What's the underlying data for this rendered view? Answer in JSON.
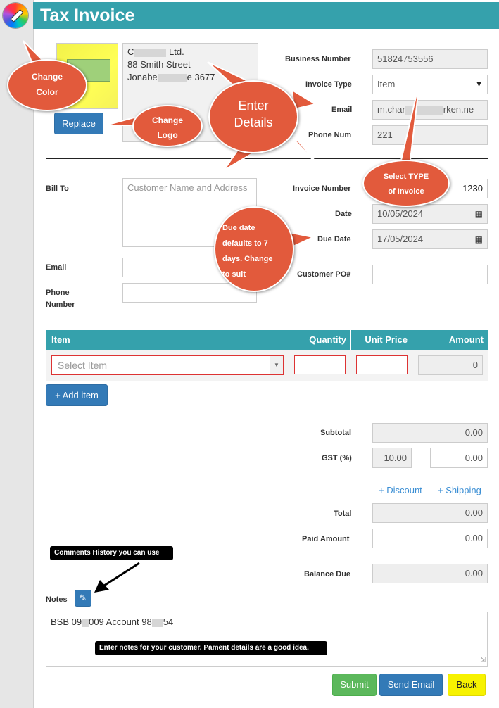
{
  "header": {
    "title": "Tax Invoice"
  },
  "company": {
    "lines": [
      "C",
      "Ltd.",
      "88 Smith Street",
      "Jonabe",
      "e 3677"
    ],
    "replace_label": "Replace"
  },
  "business": {
    "business_number_label": "Business Number",
    "business_number_value": "51824753556",
    "invoice_type_label": "Invoice Type",
    "invoice_type_value": "Item",
    "email_label": "Email",
    "email_value_start": "m.char",
    "email_value_end": "rken.ne",
    "phone_label": "Phone Num",
    "phone_value": "221"
  },
  "bill_to": {
    "label": "Bill To",
    "placeholder": "Customer Name and Address",
    "email_label": "Email",
    "phone_label_1": "Phone",
    "phone_label_2": "Number"
  },
  "invoice": {
    "number_label": "Invoice Number",
    "number_value": "1230",
    "date_label": "Date",
    "date_value": "10/05/2024",
    "due_label": "Due Date",
    "due_value": "17/05/2024",
    "po_label": "Customer PO#"
  },
  "items_table": {
    "headers": [
      "Item",
      "Quantity",
      "Unit Price",
      "Amount"
    ],
    "select_placeholder": "Select Item",
    "amount_value": "0",
    "add_item_label": "+ Add item"
  },
  "totals": {
    "subtotal_label": "Subtotal",
    "subtotal_value": "0.00",
    "gst_label": "GST (%)",
    "gst_rate": "10.00",
    "gst_value": "0.00",
    "discount_link": "+ Discount",
    "shipping_link": "+ Shipping",
    "total_label": "Total",
    "total_value": "0.00",
    "paid_label": "Paid Amount",
    "paid_value": "0.00",
    "balance_label": "Balance Due",
    "balance_value": "0.00"
  },
  "notes": {
    "label": "Notes",
    "text_a": "BSB 09",
    "text_b": "009  Account 98",
    "text_c": "54"
  },
  "actions": {
    "submit": "Submit",
    "send_email": "Send Email",
    "back": "Back"
  },
  "callouts": {
    "change_color_1": "Change",
    "change_color_2": "Color",
    "change_logo_1": "Change",
    "change_logo_2": "Logo",
    "enter_details_1": "Enter",
    "enter_details_2": "Details",
    "select_type_1": "Select TYPE",
    "select_type_2": "of Invoice",
    "due_1": "Due date",
    "due_2": "defaults to 7",
    "due_3": "days.  Change",
    "due_4": "to suit",
    "comments_tip": "Comments History you can use",
    "notes_tip": "Enter notes for your customer.  Pament details are a good idea."
  },
  "colors": {
    "accent": "#35a1ac",
    "callout": "#e25a3c",
    "primary_button": "#337ab7",
    "submit": "#5cb85c",
    "back": "#f7f200"
  }
}
